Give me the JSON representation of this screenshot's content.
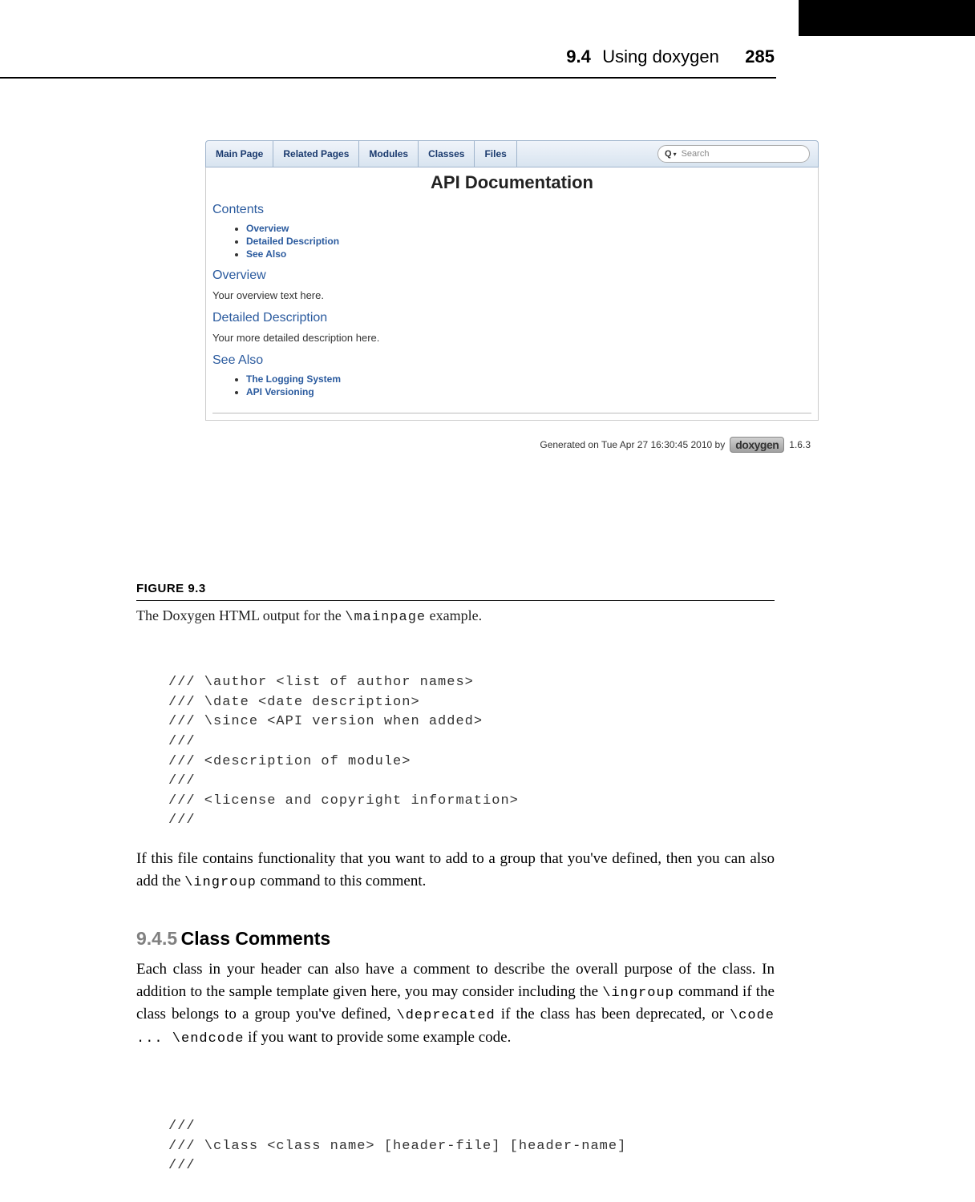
{
  "header": {
    "section": "9.4",
    "title": "Using doxygen",
    "page": "285"
  },
  "doxygen": {
    "tabs": [
      "Main Page",
      "Related Pages",
      "Modules",
      "Classes",
      "Files"
    ],
    "search_placeholder": "Search",
    "page_title": "API Documentation",
    "contents_heading": "Contents",
    "contents_items": [
      "Overview",
      "Detailed Description",
      "See Also"
    ],
    "overview_heading": "Overview",
    "overview_text": "Your overview text here.",
    "detailed_heading": "Detailed Description",
    "detailed_text": "Your more detailed description here.",
    "seealso_heading": "See Also",
    "seealso_items": [
      "The Logging System",
      "API Versioning"
    ],
    "generated_text": "Generated on Tue Apr 27 16:30:45 2010 by",
    "logo_text": "doxygen",
    "version": "1.6.3"
  },
  "figure": {
    "label": "FIGURE 9.3",
    "caption_prefix": "The Doxygen HTML output for the ",
    "caption_code": "\\mainpage",
    "caption_suffix": " example."
  },
  "code1": "/// \\author <list of author names>\n/// \\date <date description>\n/// \\since <API version when added>\n///\n/// <description of module>\n///\n/// <license and copyright information>\n///",
  "para1_a": "If this file contains functionality that you want to add to a group that you've defined, then you can also add the ",
  "para1_code": "\\ingroup",
  "para1_b": " command to this comment.",
  "section": {
    "num": "9.4.5",
    "title": "Class Comments"
  },
  "para2_a": "Each class in your header can also have a comment to describe the overall purpose of the class. In addition to the sample template given here, you may consider including the ",
  "para2_c1": "\\ingroup",
  "para2_b": " command if the class belongs to a group you've defined, ",
  "para2_c2": "\\deprecated",
  "para2_c": " if the class has been deprecated, or ",
  "para2_c3": "\\code ... \\endcode",
  "para2_d": " if you want to provide some example code.",
  "code2": "///\n/// \\class <class name> [header-file] [header-name]\n///"
}
